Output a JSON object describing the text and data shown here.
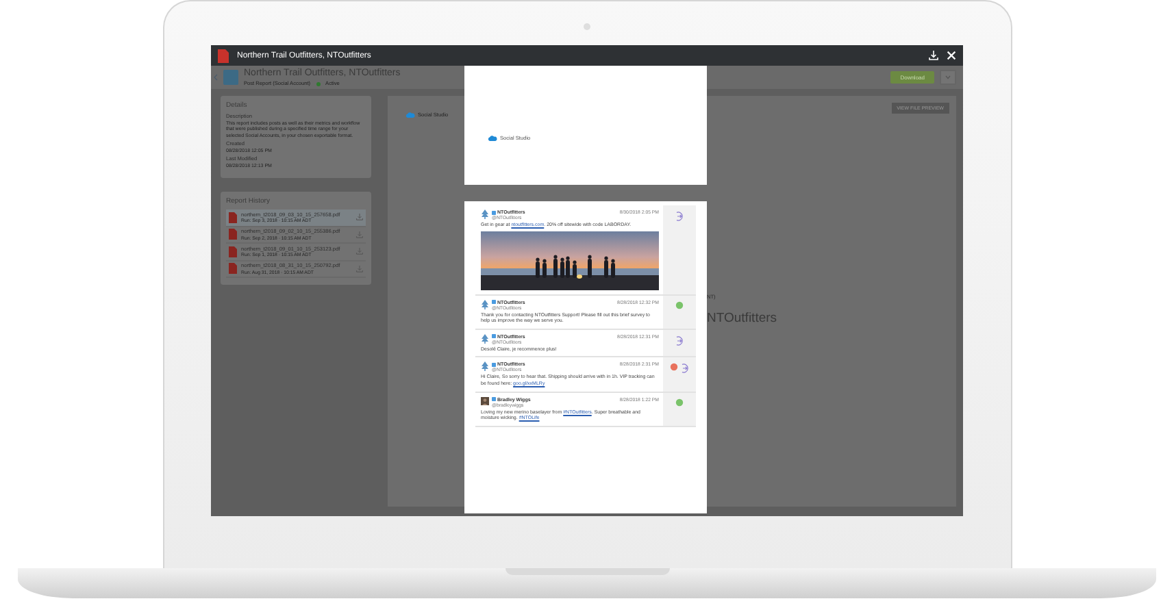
{
  "viewer": {
    "title": "Northern Trail Outfitters, NTOutfitters"
  },
  "report": {
    "title": "Northern Trail Outfitters, NTOutfitters",
    "subtitle": "Post Report (Social Account)",
    "status": "Active",
    "download_button": "Download"
  },
  "details": {
    "heading": "Details",
    "fields": [
      {
        "label": "Description",
        "value": "This report includes posts as well as their metrics and workflow that were published during a specified time range for your selected Social Accounts, in your chosen exportable format."
      },
      {
        "label": "Created",
        "value": "08/28/2018 12:05 PM"
      },
      {
        "label": "Last Modified",
        "value": "08/28/2018 12:13 PM"
      }
    ]
  },
  "report_history": {
    "heading": "Report History",
    "files": [
      {
        "name": "northern_t2018_09_03_10_15_257658.pdf",
        "run": "Run: Sep 3, 2018 · 10:15 AM ADT",
        "selected": true
      },
      {
        "name": "northern_t2018_09_02_10_15_255386.pdf",
        "run": "Run: Sep 2, 2018 · 10:15 AM ADT",
        "selected": false
      },
      {
        "name": "northern_t2018_09_01_10_15_253123.pdf",
        "run": "Run: Sep 1, 2018 · 10:15 AM ADT",
        "selected": false
      },
      {
        "name": "northern_t2018_08_31_10_15_250792.pdf",
        "run": "Run: Aug 31, 2018 · 10:15 AM ADT",
        "selected": false
      }
    ]
  },
  "preview": {
    "brand": "Social Studio",
    "button": "VIEW FILE PREVIEW",
    "caption": "NT)",
    "title": "NTOutfitters"
  },
  "cover_page": {
    "brand": "Social Studio"
  },
  "posts": [
    {
      "avatar": {
        "kind": "brand"
      },
      "author": "NTOutfitters",
      "handle": "@NTOutfitters",
      "time": "8/30/2018 2:05 PM",
      "text": [
        {
          "kind": "plain",
          "text": "Get in gear at "
        },
        {
          "kind": "link",
          "text": "ntoutfitters.com"
        },
        {
          "kind": "plain",
          "text": ". 20% off sitewide with code LABORDAY."
        }
      ],
      "media": {
        "kind": "picture"
      },
      "actions": [
        {
          "kind": "reply"
        }
      ]
    },
    {
      "avatar": {
        "kind": "brand"
      },
      "author": "NTOutfitters",
      "handle": "@NTOutfitters",
      "time": "8/28/2018 12:32 PM",
      "text": [
        {
          "kind": "plain",
          "text": "Thank you for contacting NTOutfitters Support! Please fill out this brief survey to help us improve the way we serve you."
        }
      ],
      "actions": [
        {
          "kind": "approved"
        }
      ]
    },
    {
      "avatar": {
        "kind": "brand"
      },
      "author": "NTOutfitters",
      "handle": "@NTOutfitters",
      "time": "8/28/2018 12:31 PM",
      "text": [
        {
          "kind": "plain",
          "text": "Desolé Claire, je recommence plus!"
        }
      ],
      "actions": [
        {
          "kind": "reply"
        }
      ]
    },
    {
      "avatar": {
        "kind": "brand"
      },
      "author": "NTOutfitters",
      "handle": "@NTOutfitters",
      "time": "8/28/2018 2:31 PM",
      "text": [
        {
          "kind": "plain",
          "text": "Hi Claire, So sorry to hear that. Shipping should arrive with in 1h. VIP tracking can be found here: "
        },
        {
          "kind": "link",
          "text": "goo.gl/xxMLRy"
        }
      ],
      "actions": [
        {
          "kind": "rejected"
        },
        {
          "kind": "reply"
        }
      ]
    },
    {
      "avatar": {
        "kind": "person"
      },
      "author": "Bradley Wiggs",
      "handle": "@bradleywiggs",
      "time": "8/28/2018 1:22 PM",
      "text": [
        {
          "kind": "plain",
          "text": "Loving my new merino baselayer from "
        },
        {
          "kind": "link",
          "text": "#NTOutfitters"
        },
        {
          "kind": "plain",
          "text": ". Super breathable and moisture wicking. "
        },
        {
          "kind": "link",
          "text": "#NTOLife"
        }
      ],
      "actions": [
        {
          "kind": "approved"
        }
      ]
    }
  ]
}
